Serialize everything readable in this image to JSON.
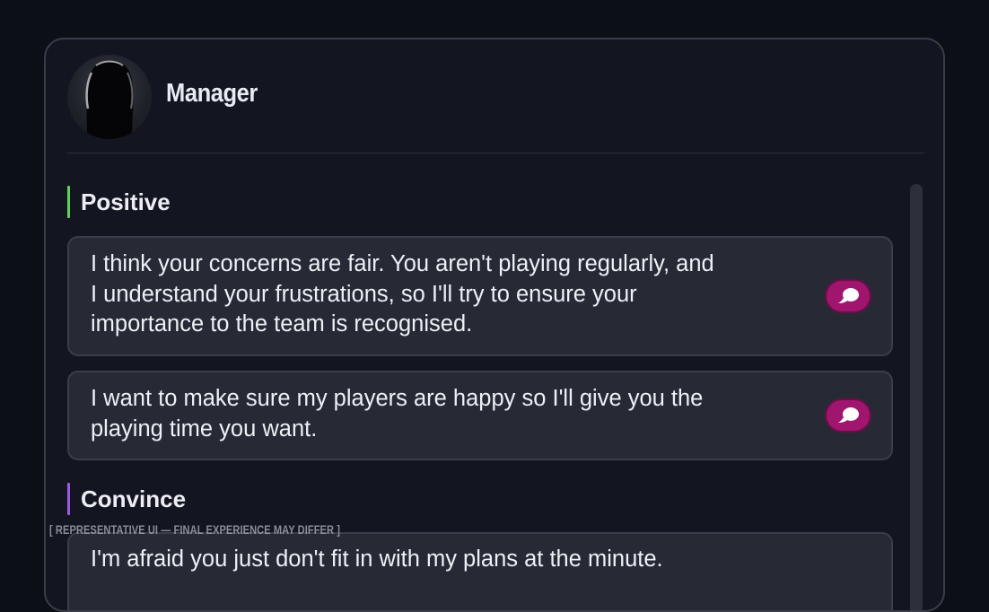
{
  "header": {
    "title": "Manager"
  },
  "sections": [
    {
      "label": "Positive",
      "accent": "#5fd35a",
      "options": [
        {
          "lines": [
            "I think your concerns are fair. You aren't playing regularly, and",
            "I understand your frustrations, so I'll try to ensure your",
            "importance to the team is recognised."
          ],
          "icon": "chat-bubble-icon"
        },
        {
          "lines": [
            "I want to make sure my players are happy so I'll give you the",
            "playing time you want."
          ],
          "icon": "chat-bubble-icon"
        }
      ]
    },
    {
      "label": "Convince",
      "accent": "#9c5ae0",
      "options": [
        {
          "lines": [
            "I'm afraid you just don't fit in with my plans at the minute."
          ]
        }
      ]
    }
  ],
  "disclaimer": "[ REPRESENTATIVE UI — FINAL EXPERIENCE MAY DIFFER ]",
  "colors": {
    "chat_button": "#a0156e",
    "background": "#0d0f16",
    "panel": "#131520",
    "option_card": "#272a35"
  }
}
